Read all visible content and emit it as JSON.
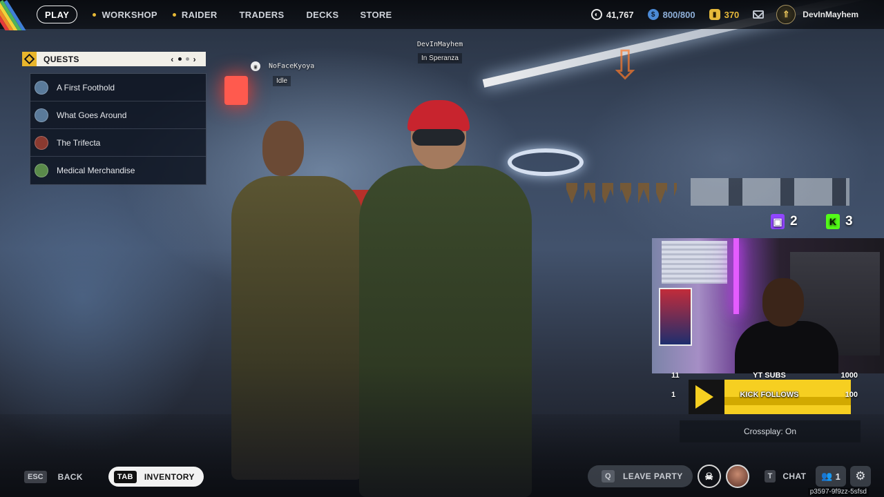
{
  "nav": {
    "play": "PLAY",
    "items": [
      {
        "label": "WORKSHOP",
        "dot": true
      },
      {
        "label": "RAIDER",
        "dot": true
      },
      {
        "label": "TRADERS",
        "dot": false
      },
      {
        "label": "DECKS",
        "dot": false
      },
      {
        "label": "STORE",
        "dot": false
      }
    ]
  },
  "currencies": {
    "credits": "41,767",
    "coins": "800/800",
    "tokens": "370"
  },
  "profile": {
    "username": "DevInMayhem"
  },
  "quests": {
    "title": "QUESTS",
    "items": [
      {
        "label": "A First Foothold",
        "color": "#5a7a9a"
      },
      {
        "label": "What Goes Around",
        "color": "#5a7a9a"
      },
      {
        "label": "The Trifecta",
        "color": "#8a3a30"
      },
      {
        "label": "Medical Merchandise",
        "color": "#5a8a4a"
      }
    ]
  },
  "players": {
    "left": {
      "name": "NoFaceKyoya",
      "status": "Idle"
    },
    "center": {
      "name": "DevInMayhem",
      "status": "In Speranza"
    }
  },
  "stream": {
    "twitch_count": "2",
    "kick_count": "3",
    "yt_goal": {
      "from": "11",
      "label": "YT SUBS",
      "to": "1000"
    },
    "kick_goal": {
      "from": "1",
      "label": "KICK FOLLOWS",
      "to": "100"
    },
    "crossplay": "Crossplay: On"
  },
  "bottom": {
    "back_key": "ESC",
    "back_label": "BACK",
    "inventory_key": "TAB",
    "inventory_label": "INVENTORY",
    "leave_key": "Q",
    "leave_label": "LEAVE PARTY",
    "chat_key": "T",
    "chat_label": "CHAT",
    "friends_count": "1"
  },
  "version": "p3597-9f9zz-5sfsd",
  "colors": {
    "accent_gold": "#e9b62c",
    "goal_yellow": "#f6cf21",
    "twitch": "#9146ff",
    "kick": "#53fc18"
  }
}
